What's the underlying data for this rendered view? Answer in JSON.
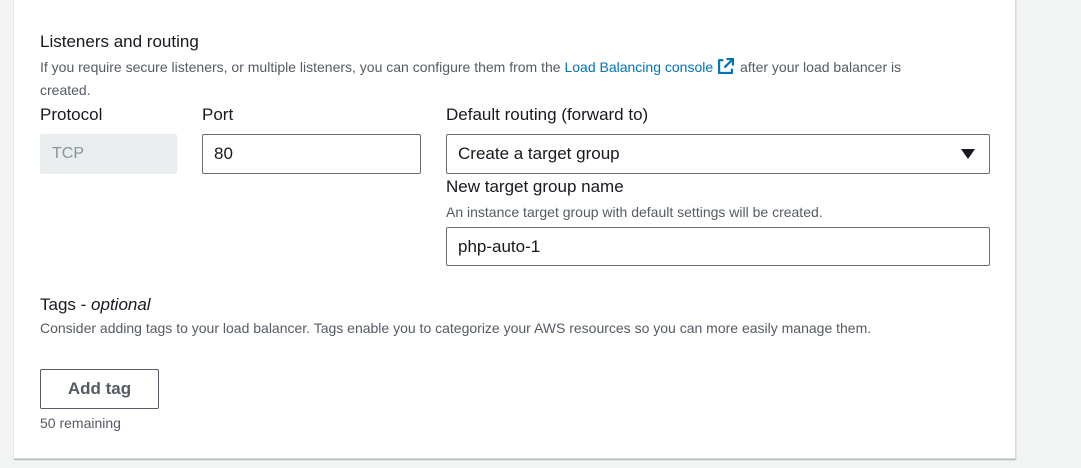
{
  "listeners": {
    "title": "Listeners and routing",
    "description_before": "If you require secure listeners, or multiple listeners, you can configure them from the ",
    "link_text": "Load Balancing console",
    "description_after_line1": " after your load balancer is",
    "description_after_line2": "created.",
    "link_icon": "external-link-icon",
    "protocol": {
      "label": "Protocol",
      "value": "TCP"
    },
    "port": {
      "label": "Port",
      "value": "80"
    },
    "default_routing": {
      "label": "Default routing (forward to)",
      "selected": "Create a target group"
    },
    "target_group": {
      "label": "New target group name",
      "description": "An instance target group with default settings will be created.",
      "value": "php-auto-1"
    }
  },
  "tags": {
    "title": "Tags - ",
    "title_optional": "optional",
    "description": "Consider adding tags to your load balancer. Tags enable you to categorize your AWS resources so you can more easily manage them.",
    "add_button": "Add tag",
    "remaining": "50 remaining"
  },
  "colors": {
    "link": "#0073bb",
    "disabled_bg": "#eaeded",
    "page_bg": "#f2f3f3"
  }
}
